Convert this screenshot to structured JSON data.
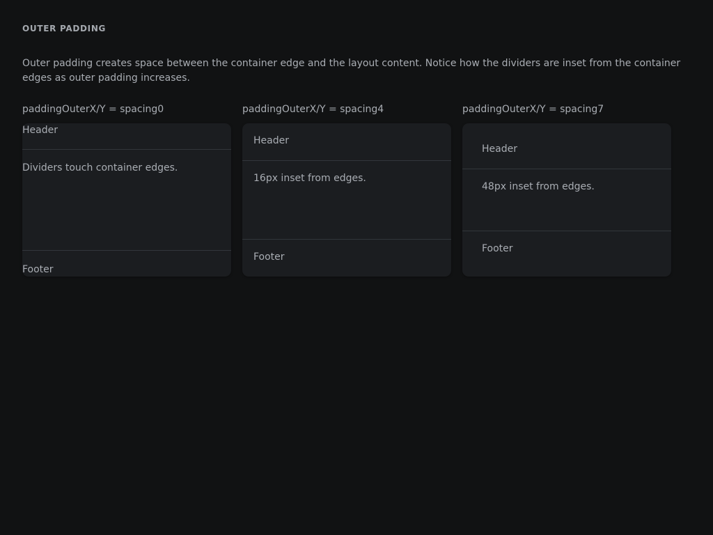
{
  "section": {
    "title": "OUTER PADDING",
    "description": "Outer padding creates space between the container edge and the layout content. Notice how the dividers are inset from the container edges as outer padding increases."
  },
  "examples": [
    {
      "label": "paddingOuterX/Y = spacing0",
      "header": "Header",
      "body": "Dividers touch container edges.",
      "footer": "Footer"
    },
    {
      "label": "paddingOuterX/Y = spacing4",
      "header": "Header",
      "body": "16px inset from edges.",
      "footer": "Footer"
    },
    {
      "label": "paddingOuterX/Y = spacing7",
      "header": "Header",
      "body": "48px inset from edges.",
      "footer": "Footer"
    }
  ],
  "colors": {
    "background": "#111213",
    "card": "#1b1d20",
    "divider": "#32363b",
    "text": "#a9adb3"
  }
}
